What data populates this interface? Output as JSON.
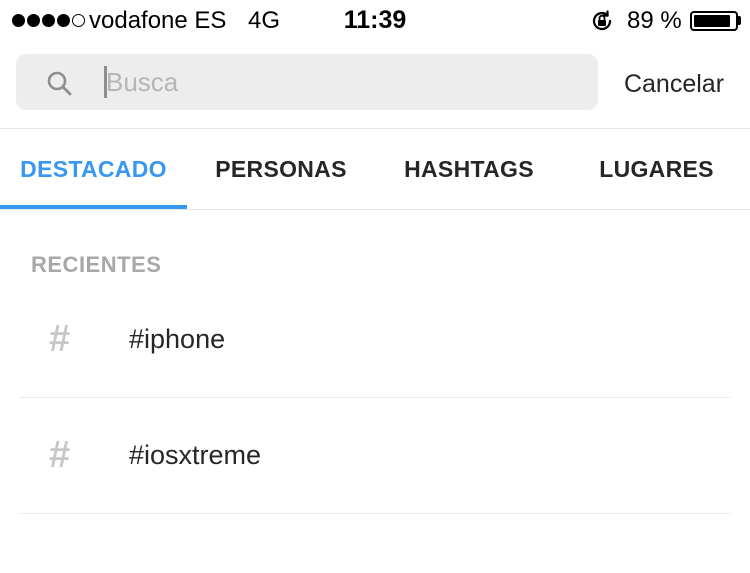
{
  "status_bar": {
    "carrier": "vodafone ES",
    "network": "4G",
    "time": "11:39",
    "battery_percent": "89 %",
    "battery_level": 0.89,
    "signal_bars_filled": 4,
    "signal_bars_total": 5,
    "rotation_lock_icon": "rotation-lock-icon"
  },
  "search": {
    "placeholder": "Busca",
    "value": "",
    "icon": "search-icon",
    "cancel_label": "Cancelar"
  },
  "tabs": [
    {
      "label": "DESTACADO",
      "active": true
    },
    {
      "label": "PERSONAS",
      "active": false
    },
    {
      "label": "HASHTAGS",
      "active": false
    },
    {
      "label": "LUGARES",
      "active": false
    }
  ],
  "recents": {
    "header": "RECIENTES",
    "items": [
      {
        "icon": "#",
        "label": "#iphone"
      },
      {
        "icon": "#",
        "label": "#iosxtreme"
      }
    ]
  },
  "colors": {
    "accent": "#3897f0",
    "text": "#262626",
    "muted": "#a8a8a8",
    "search_bg": "#ededee"
  }
}
